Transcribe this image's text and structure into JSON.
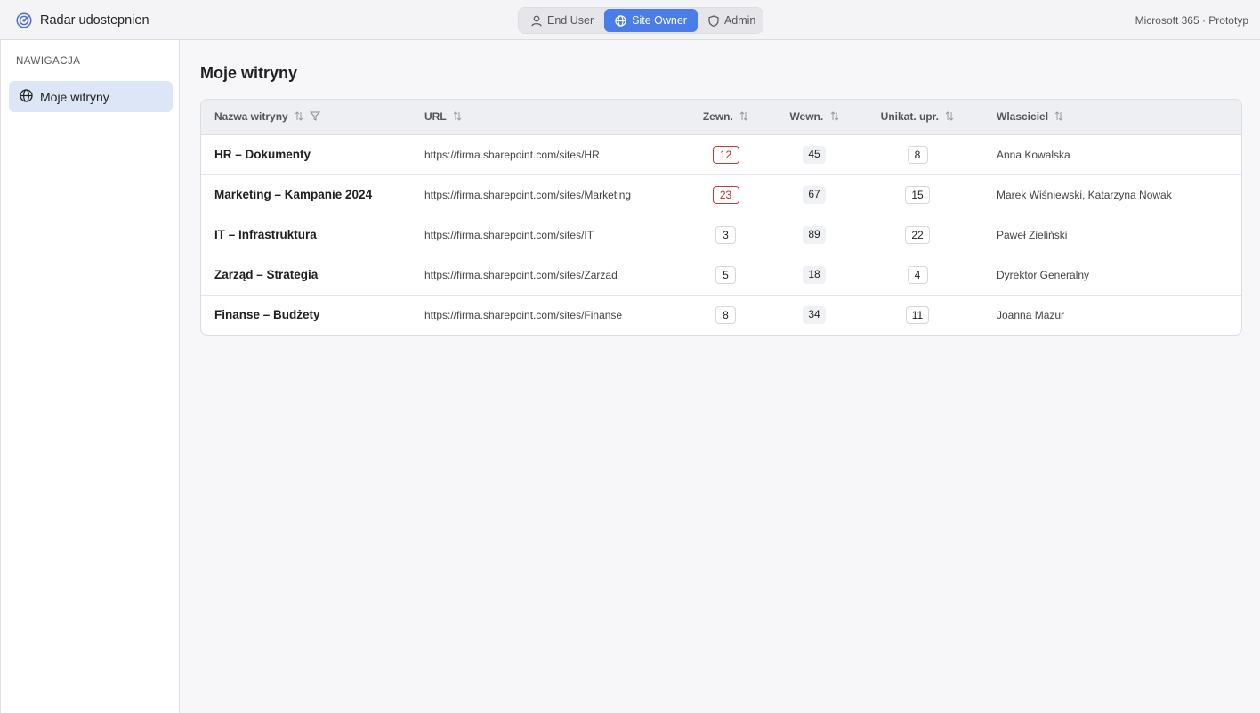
{
  "app": {
    "title": "Radar udostepnien",
    "environment": "Microsoft 365 · Prototyp"
  },
  "roles": [
    {
      "label": "End User",
      "icon": "person-icon",
      "active": false
    },
    {
      "label": "Site Owner",
      "icon": "globe-icon",
      "active": true
    },
    {
      "label": "Admin",
      "icon": "shield-icon",
      "active": false
    }
  ],
  "sidebar": {
    "heading": "NAWIGACJA",
    "items": [
      {
        "label": "Moje witryny",
        "icon": "globe-icon"
      }
    ]
  },
  "main": {
    "title": "Moje witryny",
    "columns": {
      "name": "Nazwa witryny",
      "url": "URL",
      "external": "Zewn.",
      "internal": "Wewn.",
      "unique": "Unikat. upr.",
      "owner": "Wlasciciel"
    },
    "rows": [
      {
        "name": "HR – Dokumenty",
        "url": "https://firma.sharepoint.com/sites/HR",
        "external": "12",
        "external_alert": true,
        "internal": "45",
        "unique": "8",
        "owner": "Anna Kowalska"
      },
      {
        "name": "Marketing – Kampanie 2024",
        "url": "https://firma.sharepoint.com/sites/Marketing",
        "external": "23",
        "external_alert": true,
        "internal": "67",
        "unique": "15",
        "owner": "Marek Wiśniewski, Katarzyna Nowak"
      },
      {
        "name": "IT – Infrastruktura",
        "url": "https://firma.sharepoint.com/sites/IT",
        "external": "3",
        "external_alert": false,
        "internal": "89",
        "unique": "22",
        "owner": "Paweł Zieliński"
      },
      {
        "name": "Zarząd – Strategia",
        "url": "https://firma.sharepoint.com/sites/Zarzad",
        "external": "5",
        "external_alert": false,
        "internal": "18",
        "unique": "4",
        "owner": "Dyrektor Generalny"
      },
      {
        "name": "Finanse – Budżety",
        "url": "https://firma.sharepoint.com/sites/Finanse",
        "external": "8",
        "external_alert": false,
        "internal": "34",
        "unique": "11",
        "owner": "Joanna Mazur"
      }
    ]
  },
  "colors": {
    "accent": "#4a7de8",
    "alert": "#d13438",
    "nav_active": "#dde6f7"
  }
}
